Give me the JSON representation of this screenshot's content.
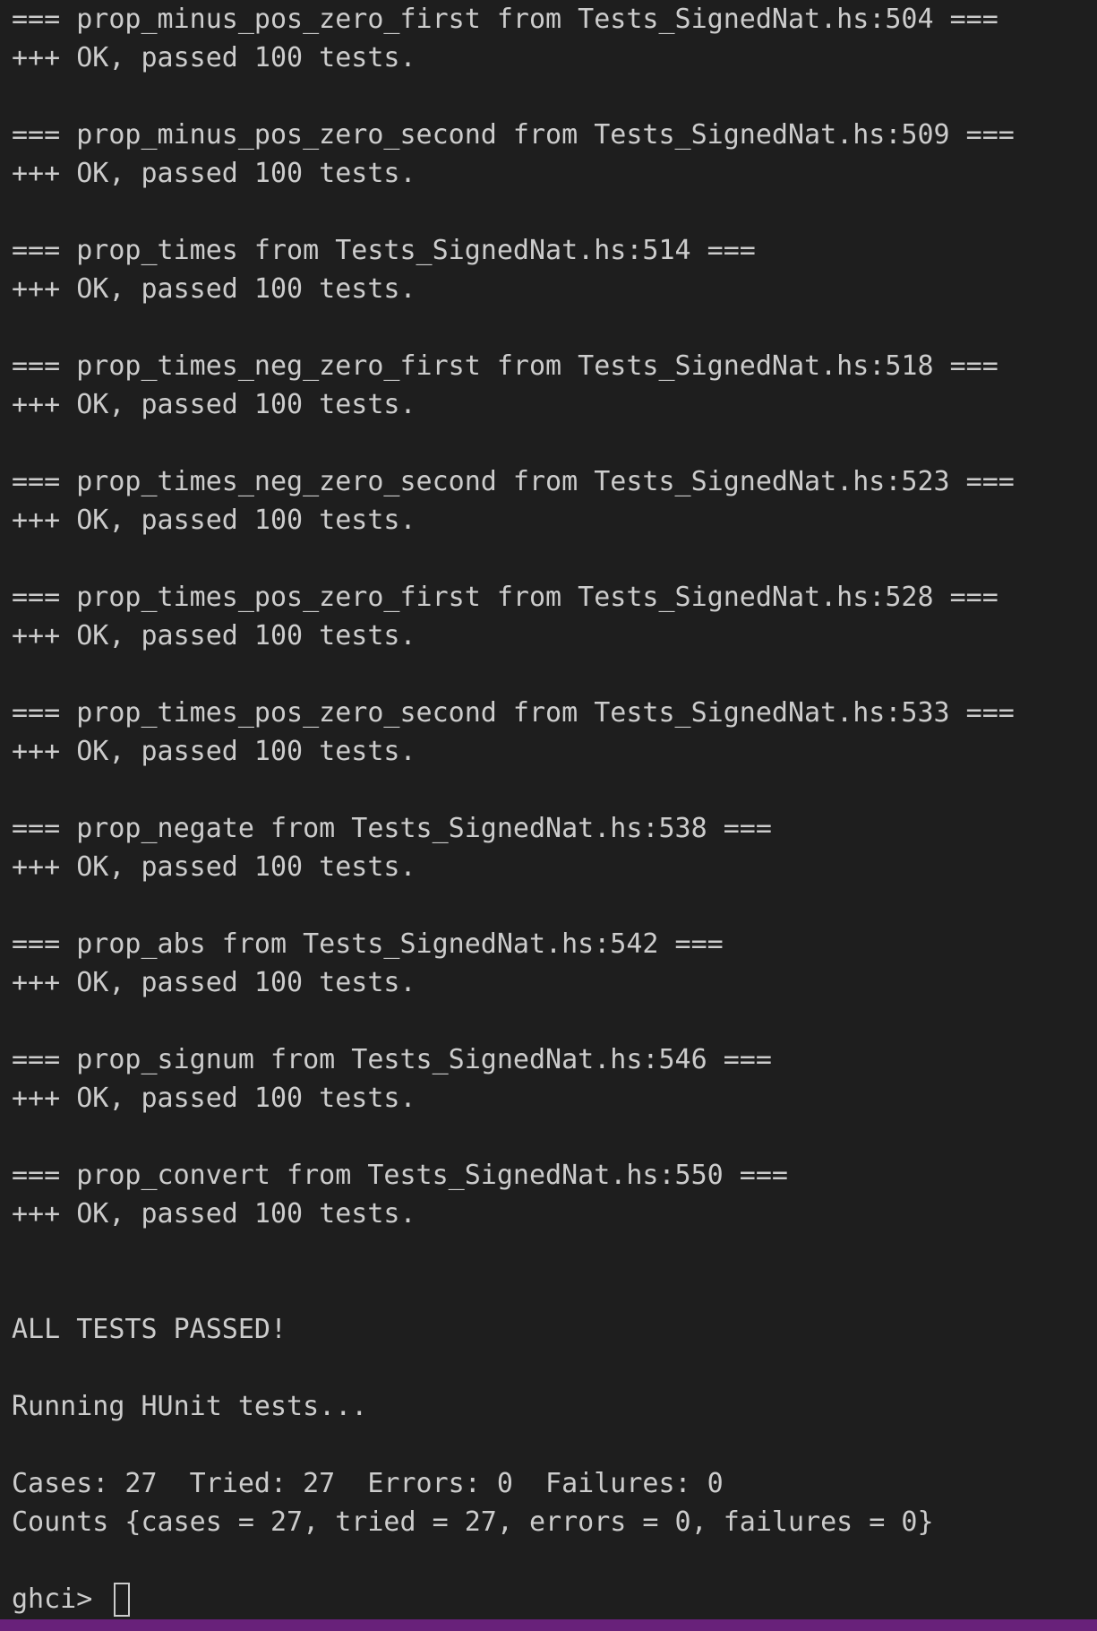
{
  "terminal": {
    "lines": [
      "=== prop_minus_pos_zero_first from Tests_SignedNat.hs:504 ===",
      "+++ OK, passed 100 tests.",
      "",
      "=== prop_minus_pos_zero_second from Tests_SignedNat.hs:509 ===",
      "+++ OK, passed 100 tests.",
      "",
      "=== prop_times from Tests_SignedNat.hs:514 ===",
      "+++ OK, passed 100 tests.",
      "",
      "=== prop_times_neg_zero_first from Tests_SignedNat.hs:518 ===",
      "+++ OK, passed 100 tests.",
      "",
      "=== prop_times_neg_zero_second from Tests_SignedNat.hs:523 ===",
      "+++ OK, passed 100 tests.",
      "",
      "=== prop_times_pos_zero_first from Tests_SignedNat.hs:528 ===",
      "+++ OK, passed 100 tests.",
      "",
      "=== prop_times_pos_zero_second from Tests_SignedNat.hs:533 ===",
      "+++ OK, passed 100 tests.",
      "",
      "=== prop_negate from Tests_SignedNat.hs:538 ===",
      "+++ OK, passed 100 tests.",
      "",
      "=== prop_abs from Tests_SignedNat.hs:542 ===",
      "+++ OK, passed 100 tests.",
      "",
      "=== prop_signum from Tests_SignedNat.hs:546 ===",
      "+++ OK, passed 100 tests.",
      "",
      "=== prop_convert from Tests_SignedNat.hs:550 ===",
      "+++ OK, passed 100 tests.",
      "",
      "",
      "ALL TESTS PASSED!",
      "",
      "Running HUnit tests...",
      "",
      "Cases: 27  Tried: 27  Errors: 0  Failures: 0",
      "Counts {cases = 27, tried = 27, errors = 0, failures = 0}",
      ""
    ],
    "prompt": "ghci> "
  },
  "colors": {
    "background": "#1e1e1e",
    "text": "#cccccc",
    "status_strip": "#68217a"
  }
}
